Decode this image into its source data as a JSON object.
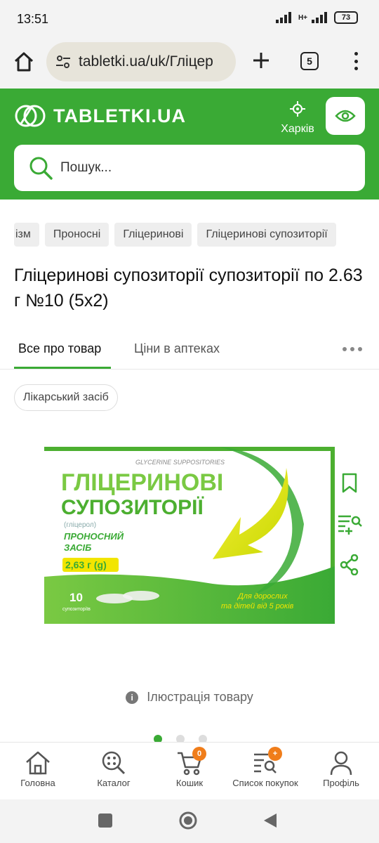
{
  "status": {
    "time": "13:51",
    "battery": "73",
    "network": "H+"
  },
  "browser": {
    "url": "tabletki.ua/uk/Гліцер",
    "tab_count": "5"
  },
  "header": {
    "logo": "TABLETKI.UA",
    "city": "Харків",
    "search_placeholder": "Пошук..."
  },
  "breadcrumbs": [
    "ізм",
    "Проносні",
    "Гліцеринові",
    "Гліцеринові супозиторії"
  ],
  "product": {
    "title": "Гліцеринові супозиторії супозиторії по 2.63 г №10 (5х2)",
    "category_badge": "Лікарський засіб"
  },
  "tabs": [
    {
      "label": "Все про товар",
      "active": true
    },
    {
      "label": "Ціни в аптеках",
      "active": false
    }
  ],
  "package": {
    "latin": "GLYCERINE SUPPOSITORIES",
    "line1": "ГЛІЦЕРИНОВІ",
    "line2": "СУПОЗИТОРІЇ",
    "substance": "(гліцерол)",
    "purpose_1": "ПРОНОСНИЙ",
    "purpose_2": "ЗАСІБ",
    "dose": "2,63 г (g)",
    "count": "10",
    "count_unit": "супозиторіїв",
    "audience_1": "Для дорослих",
    "audience_2": "та дітей від 5 років"
  },
  "illustration_note": "Ілюстрація товару",
  "carousel": {
    "total": 3,
    "active": 0
  },
  "bottom_nav": [
    {
      "label": "Головна",
      "icon": "home-icon"
    },
    {
      "label": "Каталог",
      "icon": "catalog-icon"
    },
    {
      "label": "Кошик",
      "icon": "cart-icon",
      "badge": "0"
    },
    {
      "label": "Список покупок",
      "icon": "shopping-list-icon",
      "badge": "+"
    },
    {
      "label": "Профіль",
      "icon": "profile-icon"
    }
  ],
  "colors": {
    "brand_green": "#3aaa35",
    "badge_orange": "#f07d1a"
  }
}
